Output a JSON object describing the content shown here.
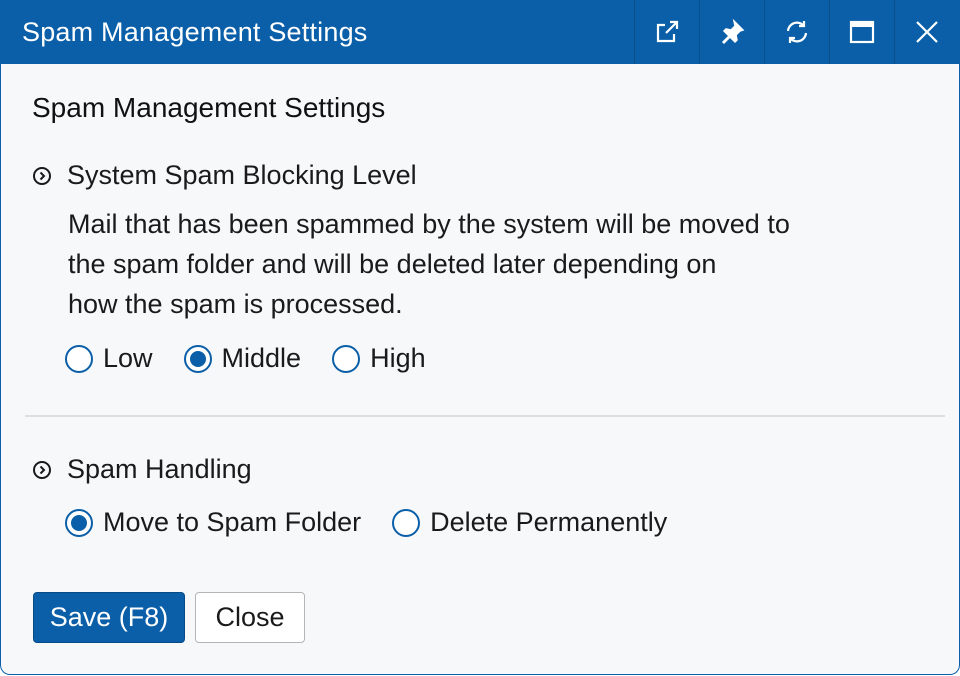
{
  "window": {
    "title": "Spam Management Settings",
    "buttons": [
      "external-link-icon",
      "pin-icon",
      "refresh-icon",
      "maximize-icon",
      "close-icon"
    ]
  },
  "page": {
    "heading": "Spam Management Settings"
  },
  "blocking": {
    "label": "System Spam Blocking Level",
    "description_lines": [
      "Mail that has been spammed by the system will be moved to",
      "the spam folder and will be deleted later depending on",
      "how the spam is processed."
    ],
    "options": [
      "Low",
      "Middle",
      "High"
    ],
    "selected": "Middle"
  },
  "handling": {
    "label": "Spam Handling",
    "options": [
      "Move to Spam Folder",
      "Delete Permanently"
    ],
    "selected": "Move to Spam Folder"
  },
  "actions": {
    "save_label": "Save (F8)",
    "close_label": "Close"
  },
  "colors": {
    "accent": "#0a5fa8",
    "background": "#f7f8fa",
    "divider": "#dedede"
  }
}
